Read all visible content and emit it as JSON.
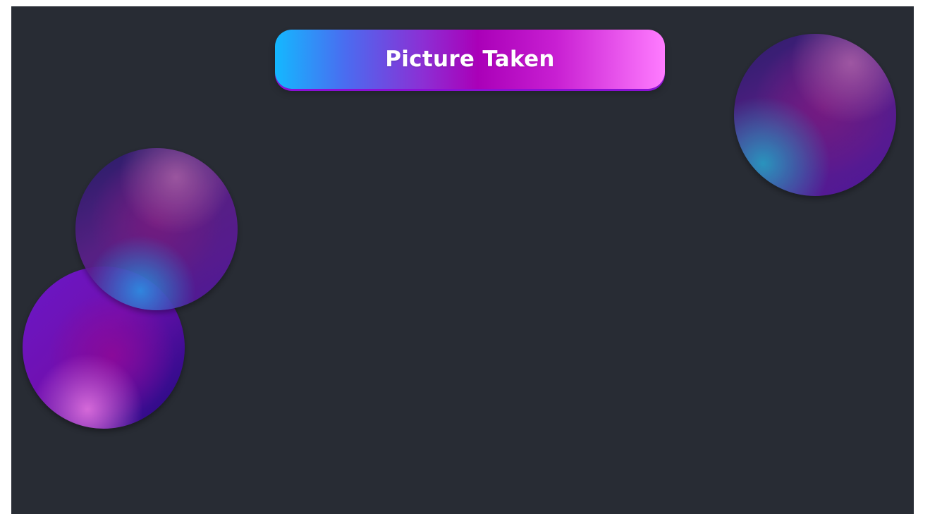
{
  "banner": {
    "title": "Picture Taken"
  },
  "decorations": {
    "orbs": [
      "orb-top-right",
      "orb-mid-left",
      "orb-bottom-left"
    ]
  },
  "colors": {
    "background": "#282c34",
    "banner_gradient_start": "#14b8ff",
    "banner_gradient_mid": "#aa00b8",
    "banner_gradient_end": "#ff7cff",
    "orb_purple": "#5a1f8a",
    "orb_blue_accent": "#2896e6",
    "orb_pink_accent": "#dc6edc"
  }
}
